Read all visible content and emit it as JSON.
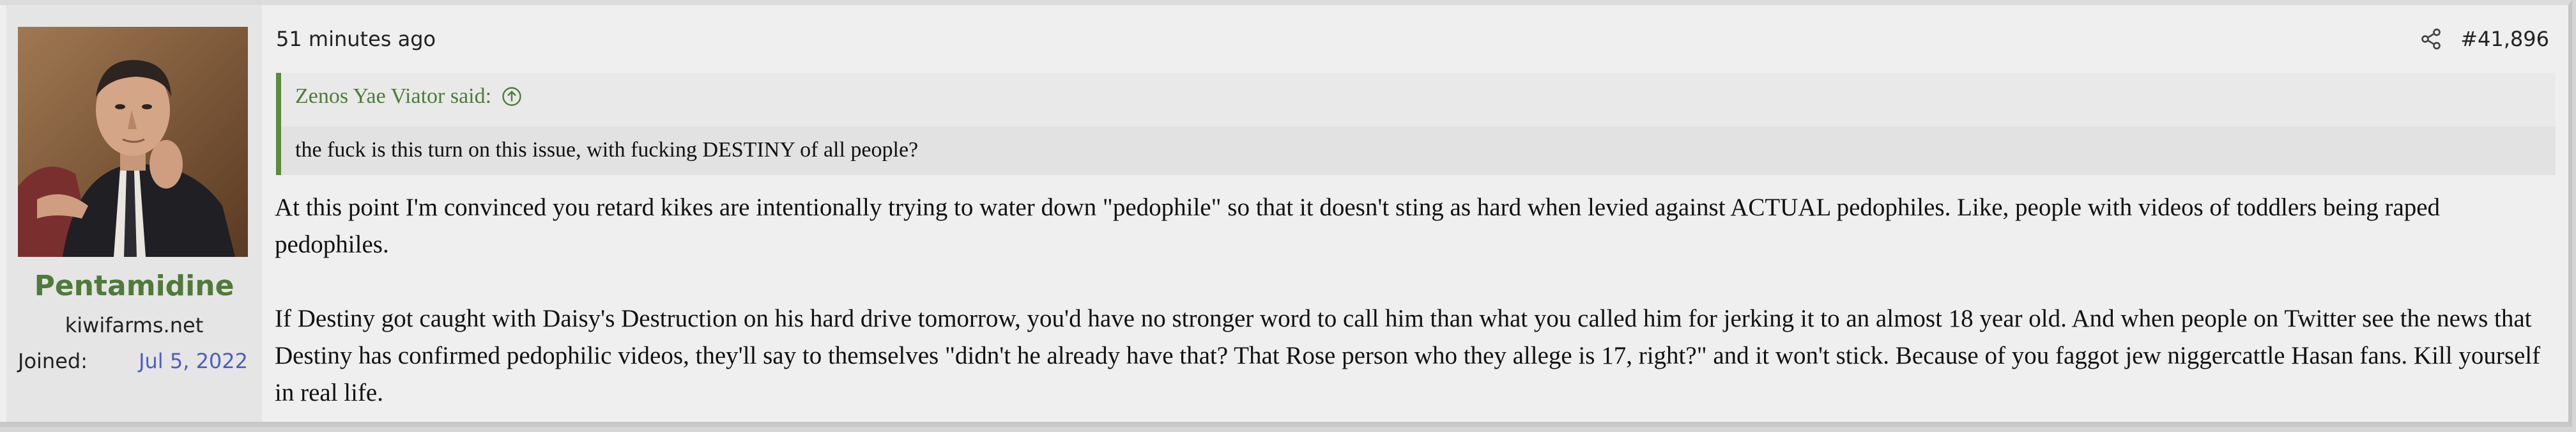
{
  "post": {
    "time": "51 minutes ago",
    "post_number": "#41,896",
    "share_icon": "share-icon"
  },
  "user": {
    "name": "Pentamidine",
    "title": "kiwifarms.net",
    "joined_label": "Joined:",
    "joined_value": "Jul 5, 2022",
    "name_color": "#4f7a3a"
  },
  "quote": {
    "author": "Zenos Yae Viator said:",
    "text": "the fuck is this turn on this issue, with fucking DESTINY of all people?",
    "border_color": "#5c8a3e"
  },
  "body": {
    "paragraphs": [
      "At this point I'm convinced you retard kikes are intentionally trying to water down \"pedophile\" so that it doesn't sting as hard when levied against ACTUAL pedophiles. Like, people with videos of toddlers being raped pedophiles.",
      "If Destiny got caught with Daisy's Destruction on his hard drive tomorrow, you'd have no stronger word to call him than what you called him for jerking it to an almost 18 year old. And when people on Twitter see the news that Destiny has confirmed pedophilic videos, they'll say to themselves \"didn't he already have that? That Rose person who they allege is 17, right?\" and it won't stick. Because of you faggot jew niggercattle Hasan fans. Kill yourself in real life."
    ]
  }
}
